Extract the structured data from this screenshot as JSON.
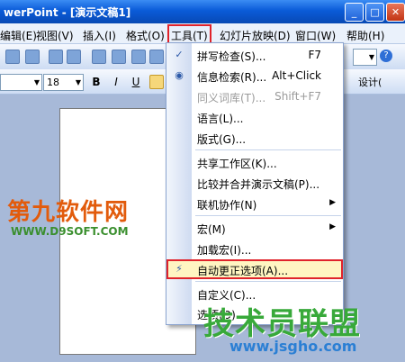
{
  "window": {
    "title": "werPoint - [演示文稿1]",
    "min_label": "_",
    "max_label": "□",
    "close_label": "✕"
  },
  "menubar": {
    "items": [
      {
        "label": "编辑(E)"
      },
      {
        "label": "视图(V)"
      },
      {
        "label": "插入(I)"
      },
      {
        "label": "格式(O)"
      },
      {
        "label": "工具(T)"
      },
      {
        "label": "幻灯片放映(D)"
      },
      {
        "label": "窗口(W)"
      },
      {
        "label": "帮助(H)"
      }
    ]
  },
  "toolbar": {
    "font_size": "18",
    "bold": "B",
    "italic": "I",
    "underline": "U",
    "design_label": "设计(",
    "help_glyph": "?"
  },
  "tools_menu": {
    "items": [
      {
        "label": "拼写检查(S)...",
        "shortcut": "F7"
      },
      {
        "label": "信息检索(R)...",
        "shortcut": "Alt+Click"
      },
      {
        "label": "同义词库(T)...",
        "shortcut": "Shift+F7"
      },
      {
        "label": "语言(L)..."
      },
      {
        "label": "版式(G)..."
      },
      {
        "label": "共享工作区(K)..."
      },
      {
        "label": "比较并合并演示文稿(P)..."
      },
      {
        "label": "联机协作(N)"
      },
      {
        "label": "宏(M)"
      },
      {
        "label": "加载宏(I)..."
      },
      {
        "label": "自动更正选项(A)..."
      },
      {
        "label": "自定义(C)..."
      },
      {
        "label": "选项(O)..."
      }
    ]
  },
  "watermarks": {
    "site1": "第九软件网",
    "site1_url": "WWW.D9SOFT.COM",
    "site2": "技术员联盟",
    "site2_url": "www.jsgho.com"
  },
  "colors": {
    "highlight_border": "#e0232b",
    "title_blue": "#0a5bd8"
  }
}
